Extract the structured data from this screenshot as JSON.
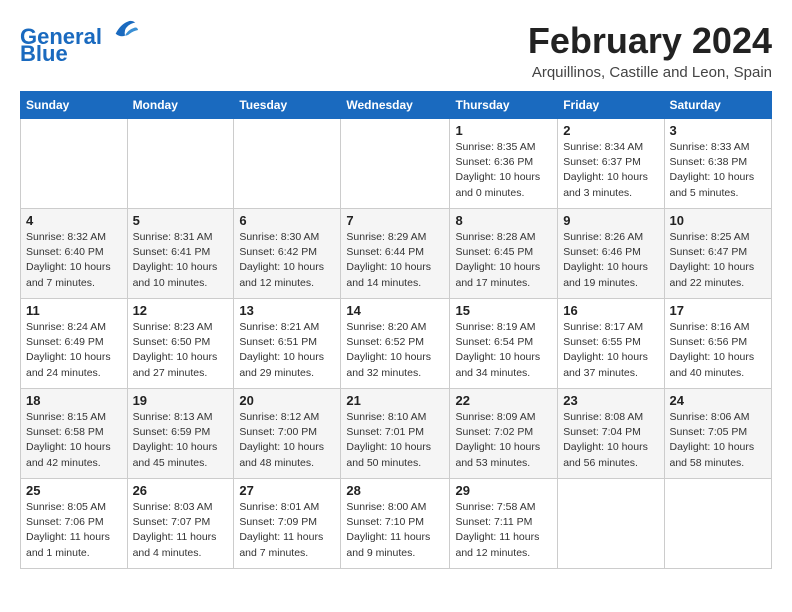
{
  "header": {
    "logo_line1": "General",
    "logo_line2": "Blue",
    "month_year": "February 2024",
    "location": "Arquillinos, Castille and Leon, Spain"
  },
  "weekdays": [
    "Sunday",
    "Monday",
    "Tuesday",
    "Wednesday",
    "Thursday",
    "Friday",
    "Saturday"
  ],
  "weeks": [
    [
      {
        "day": "",
        "info": ""
      },
      {
        "day": "",
        "info": ""
      },
      {
        "day": "",
        "info": ""
      },
      {
        "day": "",
        "info": ""
      },
      {
        "day": "1",
        "info": "Sunrise: 8:35 AM\nSunset: 6:36 PM\nDaylight: 10 hours and 0 minutes."
      },
      {
        "day": "2",
        "info": "Sunrise: 8:34 AM\nSunset: 6:37 PM\nDaylight: 10 hours and 3 minutes."
      },
      {
        "day": "3",
        "info": "Sunrise: 8:33 AM\nSunset: 6:38 PM\nDaylight: 10 hours and 5 minutes."
      }
    ],
    [
      {
        "day": "4",
        "info": "Sunrise: 8:32 AM\nSunset: 6:40 PM\nDaylight: 10 hours and 7 minutes."
      },
      {
        "day": "5",
        "info": "Sunrise: 8:31 AM\nSunset: 6:41 PM\nDaylight: 10 hours and 10 minutes."
      },
      {
        "day": "6",
        "info": "Sunrise: 8:30 AM\nSunset: 6:42 PM\nDaylight: 10 hours and 12 minutes."
      },
      {
        "day": "7",
        "info": "Sunrise: 8:29 AM\nSunset: 6:44 PM\nDaylight: 10 hours and 14 minutes."
      },
      {
        "day": "8",
        "info": "Sunrise: 8:28 AM\nSunset: 6:45 PM\nDaylight: 10 hours and 17 minutes."
      },
      {
        "day": "9",
        "info": "Sunrise: 8:26 AM\nSunset: 6:46 PM\nDaylight: 10 hours and 19 minutes."
      },
      {
        "day": "10",
        "info": "Sunrise: 8:25 AM\nSunset: 6:47 PM\nDaylight: 10 hours and 22 minutes."
      }
    ],
    [
      {
        "day": "11",
        "info": "Sunrise: 8:24 AM\nSunset: 6:49 PM\nDaylight: 10 hours and 24 minutes."
      },
      {
        "day": "12",
        "info": "Sunrise: 8:23 AM\nSunset: 6:50 PM\nDaylight: 10 hours and 27 minutes."
      },
      {
        "day": "13",
        "info": "Sunrise: 8:21 AM\nSunset: 6:51 PM\nDaylight: 10 hours and 29 minutes."
      },
      {
        "day": "14",
        "info": "Sunrise: 8:20 AM\nSunset: 6:52 PM\nDaylight: 10 hours and 32 minutes."
      },
      {
        "day": "15",
        "info": "Sunrise: 8:19 AM\nSunset: 6:54 PM\nDaylight: 10 hours and 34 minutes."
      },
      {
        "day": "16",
        "info": "Sunrise: 8:17 AM\nSunset: 6:55 PM\nDaylight: 10 hours and 37 minutes."
      },
      {
        "day": "17",
        "info": "Sunrise: 8:16 AM\nSunset: 6:56 PM\nDaylight: 10 hours and 40 minutes."
      }
    ],
    [
      {
        "day": "18",
        "info": "Sunrise: 8:15 AM\nSunset: 6:58 PM\nDaylight: 10 hours and 42 minutes."
      },
      {
        "day": "19",
        "info": "Sunrise: 8:13 AM\nSunset: 6:59 PM\nDaylight: 10 hours and 45 minutes."
      },
      {
        "day": "20",
        "info": "Sunrise: 8:12 AM\nSunset: 7:00 PM\nDaylight: 10 hours and 48 minutes."
      },
      {
        "day": "21",
        "info": "Sunrise: 8:10 AM\nSunset: 7:01 PM\nDaylight: 10 hours and 50 minutes."
      },
      {
        "day": "22",
        "info": "Sunrise: 8:09 AM\nSunset: 7:02 PM\nDaylight: 10 hours and 53 minutes."
      },
      {
        "day": "23",
        "info": "Sunrise: 8:08 AM\nSunset: 7:04 PM\nDaylight: 10 hours and 56 minutes."
      },
      {
        "day": "24",
        "info": "Sunrise: 8:06 AM\nSunset: 7:05 PM\nDaylight: 10 hours and 58 minutes."
      }
    ],
    [
      {
        "day": "25",
        "info": "Sunrise: 8:05 AM\nSunset: 7:06 PM\nDaylight: 11 hours and 1 minute."
      },
      {
        "day": "26",
        "info": "Sunrise: 8:03 AM\nSunset: 7:07 PM\nDaylight: 11 hours and 4 minutes."
      },
      {
        "day": "27",
        "info": "Sunrise: 8:01 AM\nSunset: 7:09 PM\nDaylight: 11 hours and 7 minutes."
      },
      {
        "day": "28",
        "info": "Sunrise: 8:00 AM\nSunset: 7:10 PM\nDaylight: 11 hours and 9 minutes."
      },
      {
        "day": "29",
        "info": "Sunrise: 7:58 AM\nSunset: 7:11 PM\nDaylight: 11 hours and 12 minutes."
      },
      {
        "day": "",
        "info": ""
      },
      {
        "day": "",
        "info": ""
      }
    ]
  ]
}
